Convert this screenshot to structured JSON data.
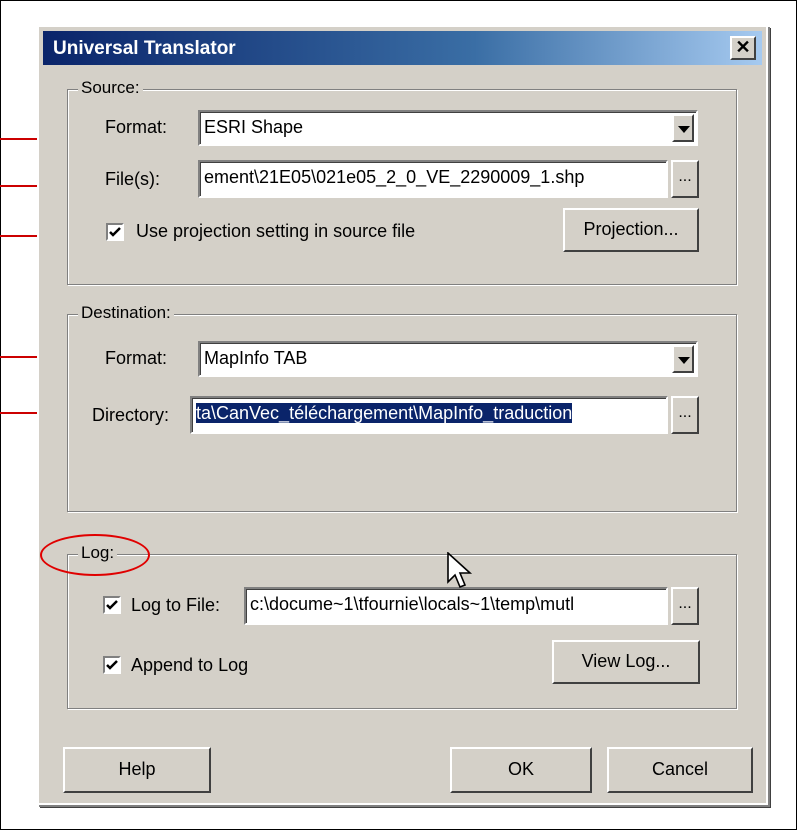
{
  "window": {
    "title": "Universal Translator",
    "close_glyph": "✕"
  },
  "source": {
    "legend": "Source:",
    "format_label": "Format:",
    "format_value": "ESRI Shape",
    "files_label": "File(s):",
    "files_value": "ement\\21E05\\021e05_2_0_VE_2290009_1.shp",
    "browse_label": "...",
    "use_projection_label": "Use projection setting in source file",
    "use_projection_checked": true,
    "projection_button": "Projection..."
  },
  "destination": {
    "legend": "Destination:",
    "format_label": "Format:",
    "format_value": "MapInfo TAB",
    "directory_label": "Directory:",
    "directory_value": "ta\\CanVec_téléchargement\\MapInfo_traduction",
    "browse_label": "..."
  },
  "log": {
    "legend": "Log:",
    "log_to_file_label": "Log to File:",
    "log_to_file_checked": true,
    "log_file_value": "c:\\docume~1\\tfournie\\locals~1\\temp\\mutl",
    "browse_label": "...",
    "append_label": "Append to Log",
    "append_checked": true,
    "view_log_button": "View Log..."
  },
  "footer": {
    "help": "Help",
    "ok": "OK",
    "cancel": "Cancel"
  },
  "colors": {
    "annotation": "#cc0000",
    "titlebar": "#0a246a",
    "dialog": "#d4d0c8"
  },
  "icons": {
    "dropdown": "chevron-down-icon",
    "checkbox": "checkmark-icon",
    "cursor": "mouse-pointer-icon"
  }
}
